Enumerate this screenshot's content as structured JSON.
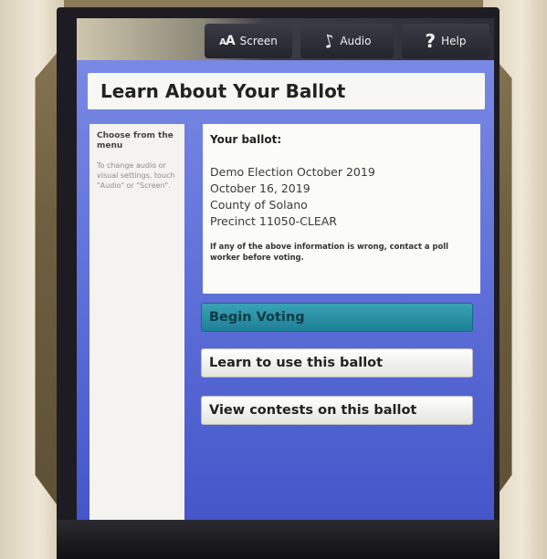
{
  "topbar": {
    "screen_label": "Screen",
    "audio_label": "Audio",
    "help_label": "Help"
  },
  "page_title": "Learn About Your Ballot",
  "sidebar": {
    "heading": "Choose from the menu",
    "text": "To change audio or visual settings, touch \"Audio\" or \"Screen\"."
  },
  "ballot": {
    "heading": "Your ballot:",
    "election": "Demo Election October 2019",
    "date": "October 16, 2019",
    "county": "County of Solano",
    "precinct": "Precinct 11050-CLEAR",
    "warning": "If any of the above information is wrong, contact a poll worker before voting."
  },
  "actions": {
    "begin_voting": "Begin Voting",
    "learn_ballot": "Learn to use this ballot",
    "view_contests": "View contests on this ballot"
  },
  "icons": {
    "screen": "text-size-icon",
    "audio": "audio-icon",
    "help": "help-icon"
  },
  "colors": {
    "screen_bg": "#6272d9",
    "begin_button": "#2a90a7",
    "topbar": "#2d2d36"
  }
}
